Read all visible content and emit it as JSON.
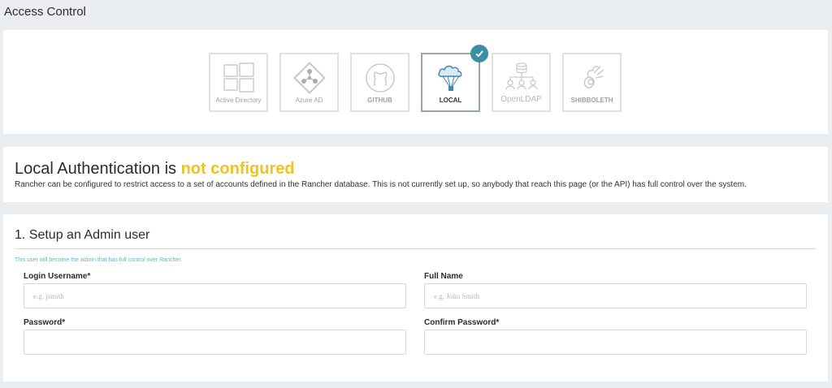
{
  "page": {
    "title": "Access Control"
  },
  "providers": [
    {
      "id": "active-directory",
      "label": "Active Directory",
      "icon": "windows-icon",
      "selected": false
    },
    {
      "id": "azure-ad",
      "label": "Azure AD",
      "icon": "azure-ad-icon",
      "selected": false
    },
    {
      "id": "github",
      "label": "GITHUB",
      "icon": "github-icon",
      "selected": false
    },
    {
      "id": "local",
      "label": "LOCAL",
      "icon": "parachute-cloud-icon",
      "selected": true
    },
    {
      "id": "openldap",
      "label": "OpenLDAP",
      "icon": "ldap-tree-icon",
      "selected": false
    },
    {
      "id": "shibboleth",
      "label": "SHIBBOLETH",
      "icon": "shibboleth-icon",
      "selected": false
    }
  ],
  "status": {
    "title_prefix": "Local Authentication is ",
    "title_state": "not configured",
    "description": "Rancher can be configured to restrict access to a set of accounts defined in the Rancher database. This is not currently set up, so anybody that reach this page (or the API) has full control over the system."
  },
  "setup": {
    "title": "1. Setup an Admin user",
    "helper": "This user will become the admin that has full control over Rancher.",
    "fields": {
      "username": {
        "label": "Login Username*",
        "placeholder": "e.g. jsmith",
        "value": ""
      },
      "fullname": {
        "label": "Full Name",
        "placeholder": "e.g. John Smith",
        "value": ""
      },
      "password": {
        "label": "Password*",
        "placeholder": "",
        "value": ""
      },
      "confirm": {
        "label": "Confirm Password*",
        "placeholder": "",
        "value": ""
      }
    }
  },
  "colors": {
    "accent": "#3a8fa0",
    "warning": "#f0c419",
    "helper": "#5bb7c9"
  }
}
